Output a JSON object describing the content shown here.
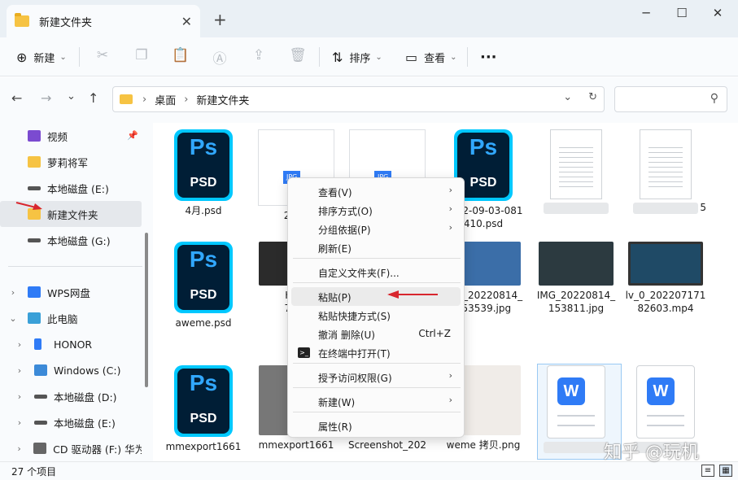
{
  "window": {
    "tab_title": "新建文件夹",
    "tab_close": "✕",
    "new_tab": "+",
    "minimize": "─",
    "maximize": "☐",
    "close": "✕"
  },
  "toolbar": {
    "new_label": "新建",
    "sort_label": "排序",
    "view_label": "查看",
    "more": "···"
  },
  "address": {
    "back": "←",
    "forward": "→",
    "recent": "⌄",
    "up": "↑",
    "crumbs": [
      "桌面",
      "新建文件夹"
    ],
    "refresh": "↻",
    "dropdown": "⌄",
    "search_placeholder": ""
  },
  "sidebar": {
    "quick": [
      {
        "label": "视频",
        "icon": "video-icon",
        "color": "#7b4bd0"
      },
      {
        "label": "萝莉将军",
        "icon": "folder-icon",
        "color": "#f6c343"
      },
      {
        "label": "本地磁盘 (E:)",
        "icon": "drive-icon",
        "color": "#555555"
      },
      {
        "label": "新建文件夹",
        "icon": "folder-icon",
        "color": "#f6c343"
      },
      {
        "label": "本地磁盘 (G:)",
        "icon": "drive-icon",
        "color": "#555555"
      }
    ],
    "tree": [
      {
        "label": "WPS网盘",
        "icon": "cloud-icon",
        "color": "#2f7bf6",
        "chev": "›"
      },
      {
        "label": "此电脑",
        "icon": "computer-icon",
        "color": "#3aa0d8",
        "chev": "⌄"
      },
      {
        "label": "HONOR",
        "icon": "phone-icon",
        "color": "#2f7bf6",
        "chev": "›"
      },
      {
        "label": "Windows (C:)",
        "icon": "windows-drive-icon",
        "color": "#3c8ad8",
        "chev": "›"
      },
      {
        "label": "本地磁盘 (D:)",
        "icon": "drive-icon",
        "color": "#555555",
        "chev": "›"
      },
      {
        "label": "本地磁盘 (E:)",
        "icon": "drive-icon",
        "color": "#555555",
        "chev": "›"
      },
      {
        "label": "CD 驱动器 (F:) 华为",
        "icon": "cd-icon",
        "color": "#666666",
        "chev": "›"
      }
    ]
  },
  "files": [
    {
      "name": "4月.psd",
      "kind": "psd"
    },
    {
      "name": "2022",
      "kind": "jpg-doc"
    },
    {
      "name": "",
      "kind": "jpg-doc"
    },
    {
      "name": "2022-09-03-081\n410.psd",
      "kind": "psd"
    },
    {
      "name": "",
      "kind": "doc",
      "blurred": true
    },
    {
      "name": "5",
      "kind": "sheet",
      "blurred": true
    },
    {
      "name": "aweme.psd",
      "kind": "psd"
    },
    {
      "name": "HiSh\n717_",
      "kind": "photo",
      "color": "#2b2b2b"
    },
    {
      "name": "IMG_20220814_\n153539.jpg",
      "kind": "photo",
      "color": "#3b6ea8"
    },
    {
      "name": "IMG_20220814_\n153811.jpg",
      "kind": "photo",
      "color": "#2c3a40"
    },
    {
      "name": "lv_0_202207171\n82603.mp4",
      "kind": "video",
      "color": "#1f4a66"
    },
    {
      "name": "mmexport1661\n",
      "kind": "psd"
    },
    {
      "name": "mmexport1661\n",
      "kind": "photo",
      "color": "#777777"
    },
    {
      "name": "Screenshot_202\n",
      "kind": "photo",
      "color": "#bdbdbd"
    },
    {
      "name": "weme 拷贝.png",
      "kind": "photo",
      "color": "#f0ece8"
    },
    {
      "name": "",
      "kind": "wps",
      "blurred": true
    },
    {
      "name": "",
      "kind": "wps",
      "blurred": true
    }
  ],
  "psd_icon": {
    "top": "Ps",
    "bottom": "PSD"
  },
  "wps_glyph": "W",
  "jpg_label": "JPG",
  "context_menu": [
    {
      "label": "查看(V)",
      "sub": true
    },
    {
      "label": "排序方式(O)",
      "sub": true
    },
    {
      "label": "分组依据(P)",
      "sub": true
    },
    {
      "label": "刷新(E)"
    },
    {
      "label": "自定义文件夹(F)..."
    },
    {
      "label": "粘贴(P)"
    },
    {
      "label": "粘贴快捷方式(S)"
    },
    {
      "label": "撤消 删除(U)",
      "shortcut": "Ctrl+Z"
    },
    {
      "label": "在终端中打开(T)"
    },
    {
      "label": "授予访问权限(G)",
      "sub": true
    },
    {
      "label": "新建(W)",
      "sub": true
    },
    {
      "label": "属性(R)"
    }
  ],
  "status": {
    "count": "27 个项目"
  },
  "watermark": "知乎 @玩机",
  "colors": {
    "accent": "#2f7bf6",
    "annotation_red": "#d8262e",
    "folder": "#f6c343",
    "ps_blue": "#31a8ff"
  }
}
